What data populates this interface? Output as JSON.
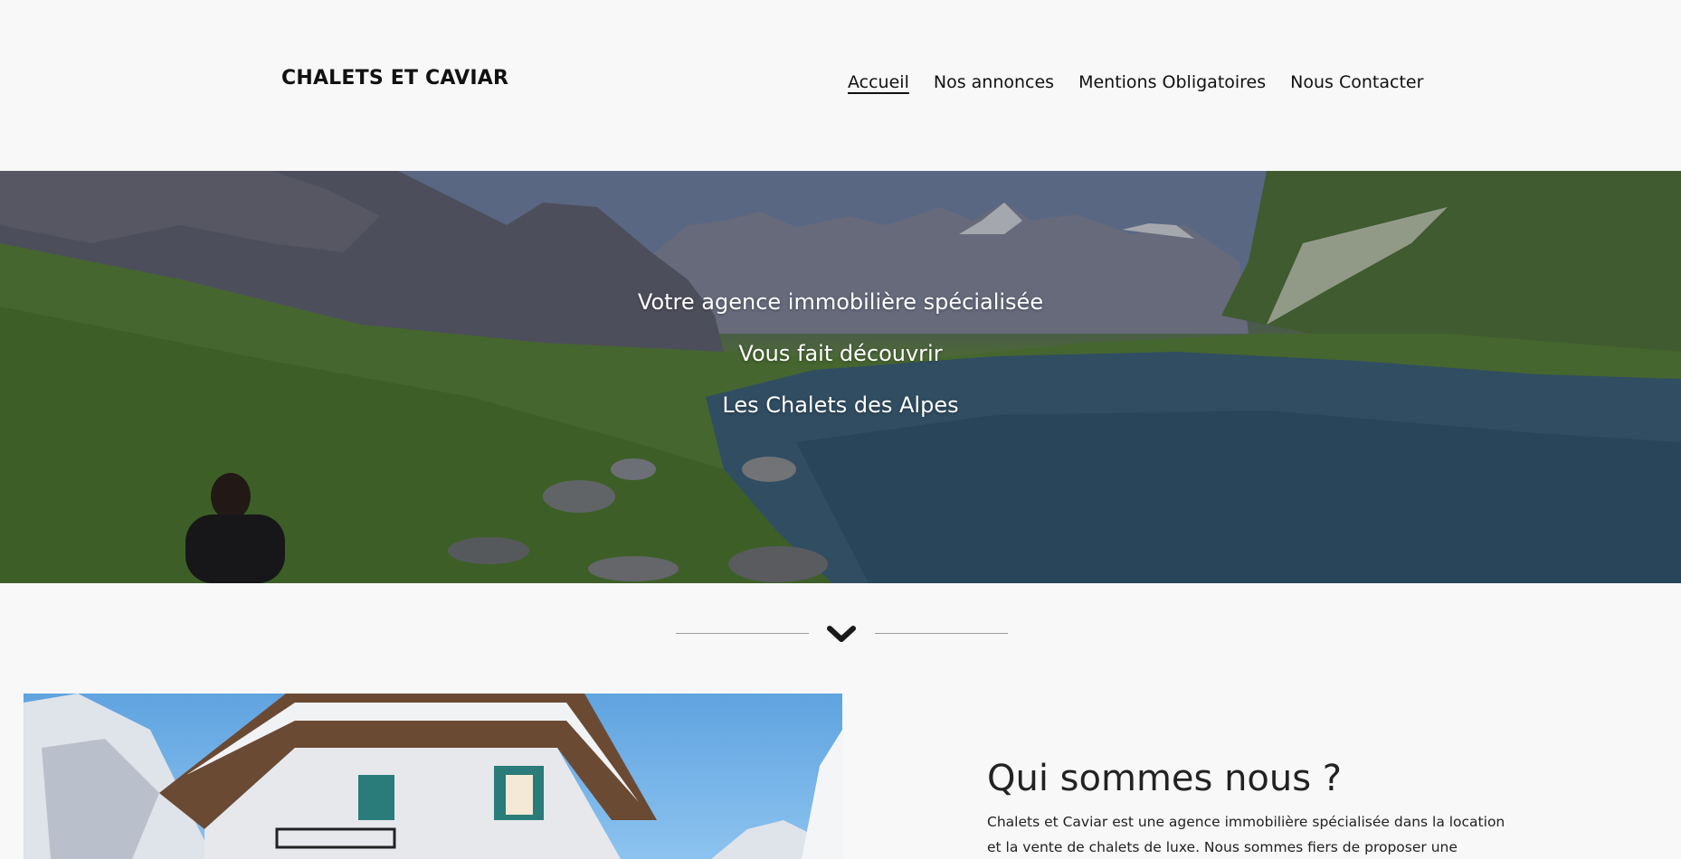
{
  "header": {
    "site_title": "CHALETS ET CAVIAR",
    "nav": [
      {
        "label": "Accueil",
        "active": true
      },
      {
        "label": "Nos annonces",
        "active": false
      },
      {
        "label": "Mentions Obligatoires",
        "active": false
      },
      {
        "label": "Nous Contacter",
        "active": false
      }
    ]
  },
  "hero": {
    "lines": [
      "Votre agence immobilière spécialisée",
      "Vous fait découvrir",
      "Les Chalets des Alpes"
    ]
  },
  "divider": {
    "icon": "chevron-down-icon"
  },
  "about": {
    "title": "Qui sommes nous ?",
    "text": "Chalets et Caviar est une agence immobilière spécialisée dans la location et la vente de chalets de luxe. Nous sommes fiers de proposer une sélection de"
  },
  "colors": {
    "background": "#f8f8f8",
    "text": "#111111",
    "hero_text": "#ffffff",
    "divider_line": "#9a9a9a"
  }
}
